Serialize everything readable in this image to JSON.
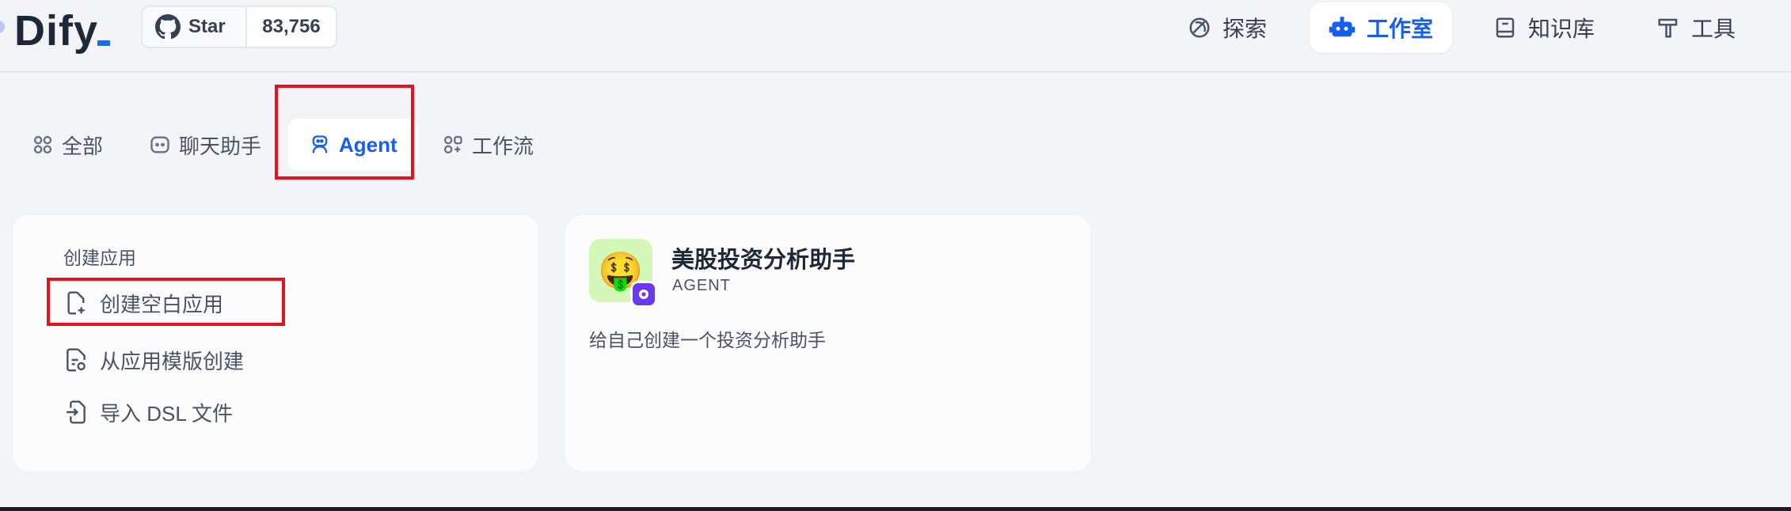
{
  "header": {
    "logo": "Dify",
    "github": {
      "label": "Star",
      "count": "83,756"
    },
    "nav": [
      {
        "label": "探索",
        "icon": "compass-icon"
      },
      {
        "label": "工作室",
        "icon": "robot-icon",
        "active": true
      },
      {
        "label": "知识库",
        "icon": "book-icon"
      },
      {
        "label": "工具",
        "icon": "hammer-icon"
      }
    ]
  },
  "tabs": [
    {
      "label": "全部",
      "icon": "grid-icon"
    },
    {
      "label": "聊天助手",
      "icon": "chat-bot-icon"
    },
    {
      "label": "Agent",
      "icon": "agent-icon",
      "active": true
    },
    {
      "label": "工作流",
      "icon": "workflow-icon"
    }
  ],
  "create": {
    "title": "创建应用",
    "items": [
      {
        "label": "创建空白应用",
        "icon": "file-plus-icon"
      },
      {
        "label": "从应用模版创建",
        "icon": "file-template-icon"
      },
      {
        "label": "导入 DSL 文件",
        "icon": "file-import-icon"
      }
    ]
  },
  "apps": [
    {
      "name": "美股投资分析助手",
      "type": "AGENT",
      "description": "给自己创建一个投资分析助手",
      "emoji": "🤑",
      "icon_bg": "#d3f8b8"
    }
  ],
  "colors": {
    "accent": "#155eef",
    "highlight": "#e8121c",
    "agent_badge": "#6938ef"
  }
}
